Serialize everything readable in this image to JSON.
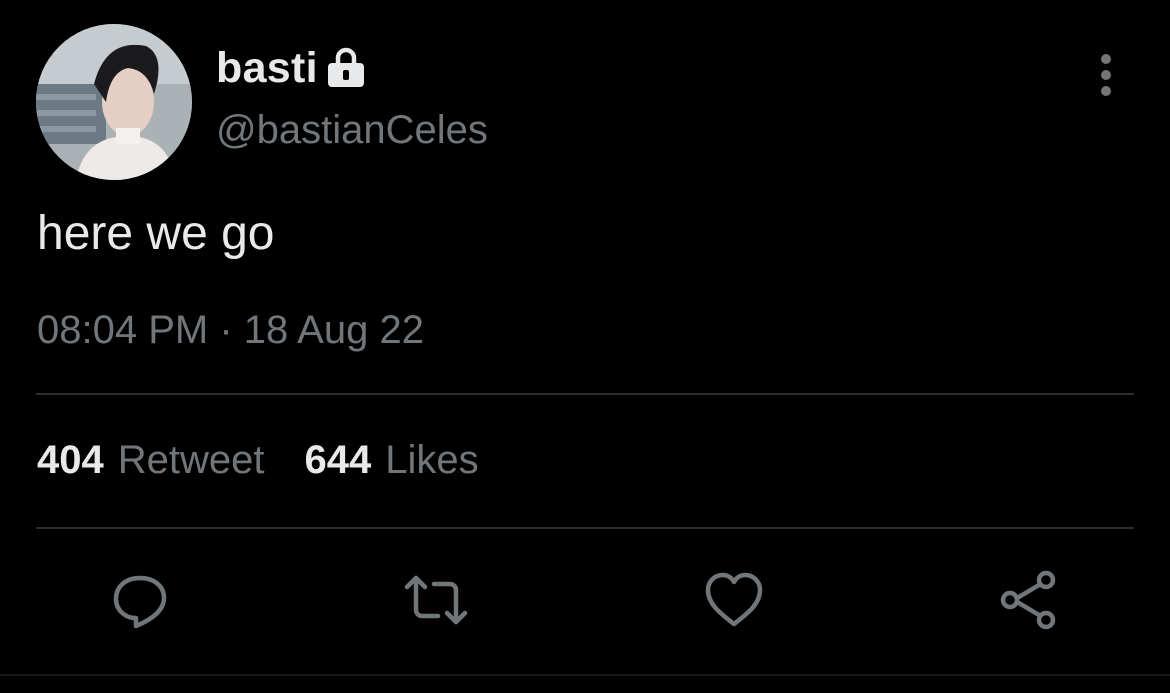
{
  "author": {
    "display_name": "basti",
    "handle": "@bastianCeles",
    "protected_icon": "lock-icon",
    "avatar_icon": "avatar-photo"
  },
  "tweet": {
    "text": "here we go",
    "timestamp": "08:04 PM · 18 Aug 22"
  },
  "stats": {
    "retweets_count": "404",
    "retweets_label": "Retweet",
    "likes_count": "644",
    "likes_label": "Likes"
  },
  "actions": [
    {
      "name": "reply",
      "icon": "reply-icon"
    },
    {
      "name": "retweet",
      "icon": "retweet-icon"
    },
    {
      "name": "like",
      "icon": "heart-icon"
    },
    {
      "name": "share",
      "icon": "share-icon"
    }
  ],
  "menu_icon": "more-vertical-icon",
  "colors": {
    "background": "#000000",
    "primary_text": "#e7e9ea",
    "secondary_text": "#71767b",
    "divider": "#2a2d31"
  }
}
